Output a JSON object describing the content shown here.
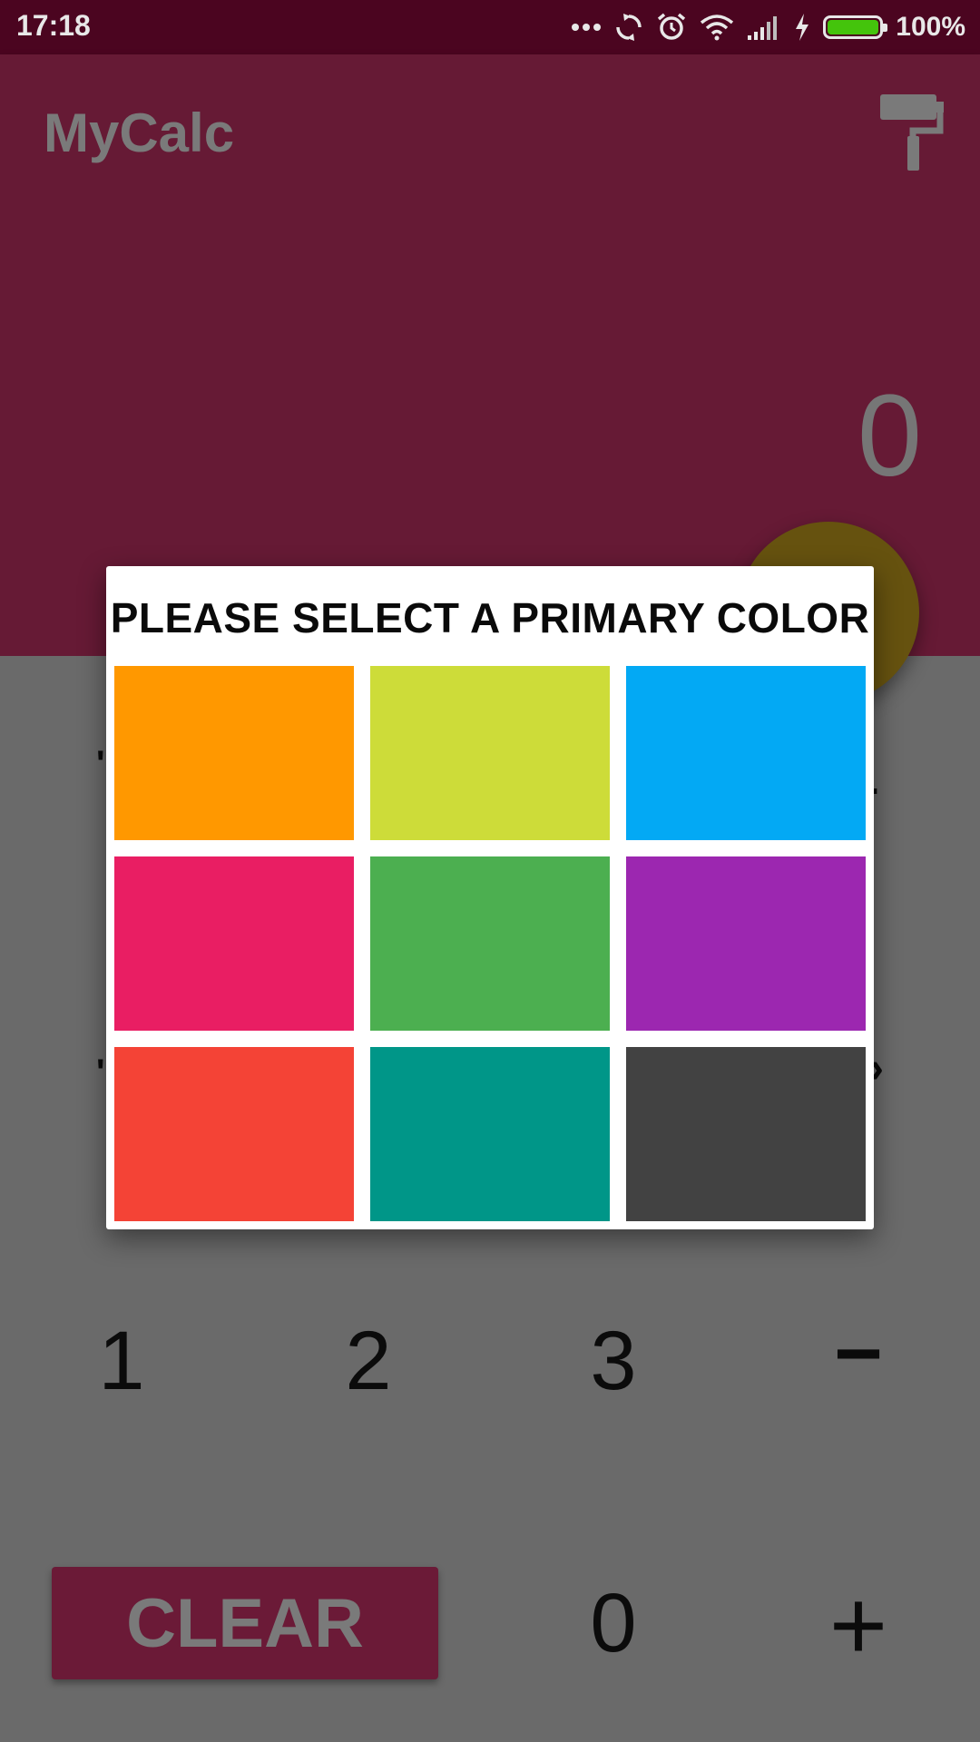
{
  "status_bar": {
    "time": "17:18",
    "battery_percent": "100%",
    "battery_level": 1.0,
    "icons": [
      "more-dots-icon",
      "sync-icon",
      "alarm-icon",
      "wifi-icon",
      "signal-icon",
      "charging-bolt-icon",
      "battery-icon"
    ]
  },
  "app_bar": {
    "title": "MyCalc",
    "action_icon": "paint-roller-icon"
  },
  "display": {
    "value": "0"
  },
  "keypad": {
    "row_1": [
      "1",
      "2",
      "3",
      "−"
    ],
    "row_2": [
      "CLEAR",
      "0",
      "+"
    ]
  },
  "dialog": {
    "title": "PLEASE SELECT A PRIMARY COLOR",
    "swatches": [
      {
        "name": "orange",
        "color": "#ff9800"
      },
      {
        "name": "lime",
        "color": "#cddc39"
      },
      {
        "name": "light-blue",
        "color": "#03a9f4"
      },
      {
        "name": "pink",
        "color": "#e91e63"
      },
      {
        "name": "green",
        "color": "#4caf50"
      },
      {
        "name": "purple",
        "color": "#9c27b0"
      },
      {
        "name": "red",
        "color": "#f44336"
      },
      {
        "name": "teal",
        "color": "#009688"
      },
      {
        "name": "dark-grey",
        "color": "#424242"
      }
    ]
  },
  "colors": {
    "primary_dark": "#4b0520",
    "primary_dimmed": "#661a35",
    "accent_dimmed": "#66520f",
    "scrim": "#6a6a6a"
  }
}
